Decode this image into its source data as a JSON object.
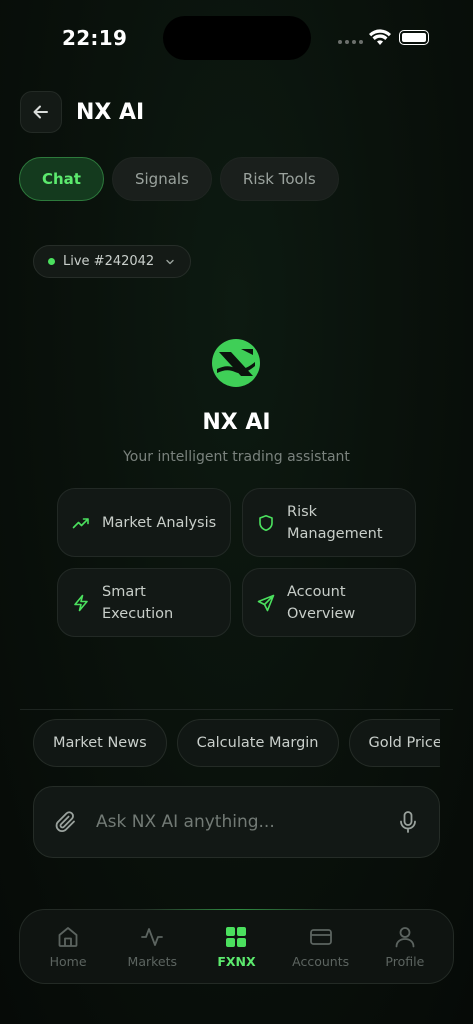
{
  "status": {
    "time": "22:19"
  },
  "header": {
    "title": "NX AI"
  },
  "tabs": [
    {
      "label": "Chat",
      "active": true
    },
    {
      "label": "Signals",
      "active": false
    },
    {
      "label": "Risk Tools",
      "active": false
    }
  ],
  "account": {
    "label": "Live #242042"
  },
  "brand": {
    "title": "NX AI",
    "subtitle": "Your intelligent trading assistant"
  },
  "features": [
    {
      "label": "Market Analysis",
      "icon": "trending-up-icon"
    },
    {
      "label": "Risk Management",
      "icon": "shield-icon"
    },
    {
      "label": "Smart Execution",
      "icon": "lightning-icon"
    },
    {
      "label": "Account Overview",
      "icon": "send-icon"
    }
  ],
  "quick_prompts": [
    "Market News",
    "Calculate Margin",
    "Gold Price"
  ],
  "input": {
    "placeholder": "Ask NX AI anything..."
  },
  "tabbar": [
    {
      "label": "Home",
      "icon": "home-icon",
      "active": false
    },
    {
      "label": "Markets",
      "icon": "activity-icon",
      "active": false
    },
    {
      "label": "FXNX",
      "icon": "grid-icon",
      "active": true
    },
    {
      "label": "Accounts",
      "icon": "card-icon",
      "active": false
    },
    {
      "label": "Profile",
      "icon": "user-icon",
      "active": false
    }
  ],
  "colors": {
    "accent": "#5cea6e",
    "background": "#0a120c"
  }
}
